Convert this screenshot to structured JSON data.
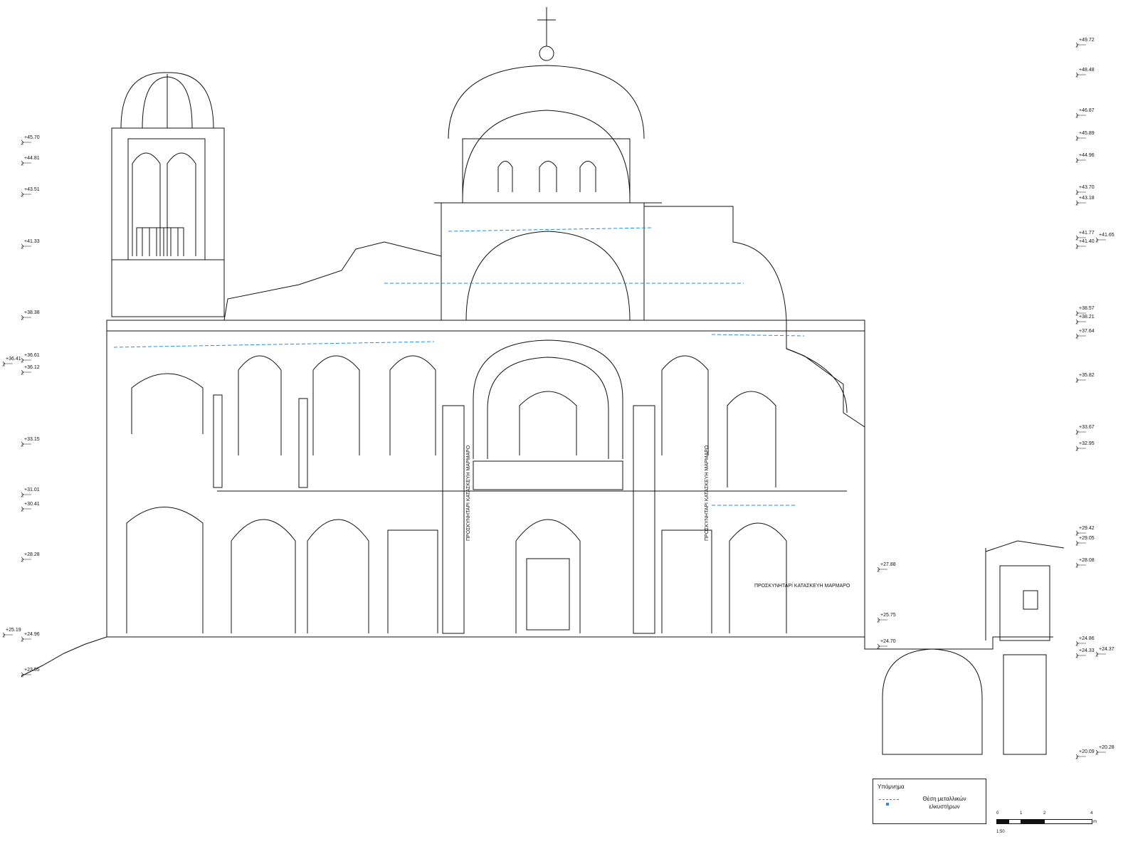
{
  "levels_left": [
    "+45.70",
    "+44.81",
    "+43.51",
    "+41.33",
    "+38.38",
    "+36.61",
    "+36.41",
    "+36.12",
    "+33.15",
    "+31.01",
    "+30.41",
    "+28.28",
    "+25.19",
    "+24.96",
    "+23.55"
  ],
  "levels_right": [
    "+49.72",
    "+48.48",
    "+46.87",
    "+45.89",
    "+44.96",
    "+43.70",
    "+43.18",
    "+41.77",
    "+41.65",
    "+41.40",
    "+38.57",
    "+38.21",
    "+37.64",
    "+35.82",
    "+33.67",
    "+32.95",
    "+29.42",
    "+29.05",
    "+28.08",
    "+24.86",
    "+24.33",
    "+24.37",
    "+20.28",
    "+20.09"
  ],
  "levels_mid": [
    "+27.88",
    "+25.75",
    "+24.70"
  ],
  "facade_labels": [
    "ΠΡΟΣΚΥΝΗΤΑΡΙ ΚΑΤΑΣΚΕΥΗ ΜΑΡΜΑΡΟ",
    "ΠΡΟΣΚΥΝΗΤΑΡΙ ΚΑΤΑΣΚΕΥΗ ΜΑΡΜΑΡΟ",
    "ΠΡΟΣΚΥΝΗΤΑΡΙ ΚΑΤΑΣΚΕΥΗ ΜΑΡΜΑΡΟ"
  ],
  "legend": {
    "title": "Υπόμνημα",
    "item": "Θέση μεταλλικών ελκυστήρων",
    "color": "#2a8be0"
  },
  "scale": {
    "ticks": [
      "0",
      "1",
      "2",
      "4"
    ],
    "unit": "m",
    "ratio": "1:50"
  }
}
